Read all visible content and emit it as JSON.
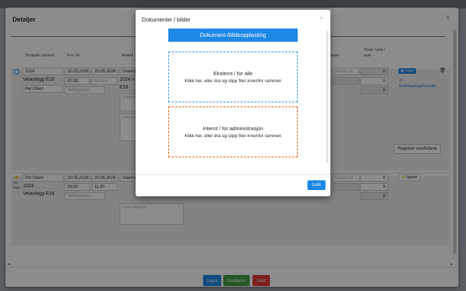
{
  "outer": {
    "title": "Detaljer",
    "close": "×",
    "headers": {
      "project": "Prosjekt / person",
      "from_to": "Fra / til",
      "work": "Arbeid",
      "pause": "Pause",
      "hours": "Timer / pris /",
      "sum": "sum"
    },
    "row1": {
      "project_code": "1024",
      "project_name": "Veianlegg E16",
      "person": "Per Olsen",
      "date_from": "20.05.2026",
      "date_to": "20.05.2026",
      "time_from": "07:00",
      "time_to": "hh:mm",
      "shift": "Skiftoppsett...",
      "work_type": "Gravingt",
      "work_line2": "1024 >",
      "work_line3": "E16",
      "diary": "Dagbok",
      "intern": "Intern-d",
      "pause": "Pause (m",
      "v1": "0",
      "v2": "0",
      "v3": "0",
      "save": "Lagre",
      "history": "Endringslogghistorikk",
      "register": "Registrer vareforbruk"
    },
    "row2": {
      "person": "Per Olsen",
      "project_code": "1024",
      "project_name": "Veianlegg E16",
      "ny": "Ny",
      "linje": "linje",
      "date_from": "20.05.2026",
      "date_to": "20.05.2026",
      "time_from": "08:00",
      "time_to": "11:00",
      "shift": "Skiftoppsett...",
      "work_type": "Graving",
      "intern": "Intern-dagbok",
      "pause": "Pause (m",
      "v1": "0",
      "v2": "0",
      "v3": "0",
      "create": "Opprett"
    },
    "footer": {
      "save": "Lagre",
      "approve": "Godkjenn",
      "delete": "Slett"
    }
  },
  "modal": {
    "title": "Dokumenter / bilder",
    "close": "×",
    "upload_button": "Dokument-/bildeopplasting",
    "external": {
      "title": "Eksternt / for alle",
      "hint": "Klikk her, eller dra og slipp filer innenfor rammen"
    },
    "internal": {
      "title": "Internt / for administrasjon",
      "hint": "Klikk her, eller dra og slipp filer innenfor rammen"
    },
    "close_button": "Lukk"
  },
  "colors": {
    "accent": "#1e88e5",
    "success": "#43a047",
    "danger": "#e53935",
    "internal_border": "#e65100"
  }
}
